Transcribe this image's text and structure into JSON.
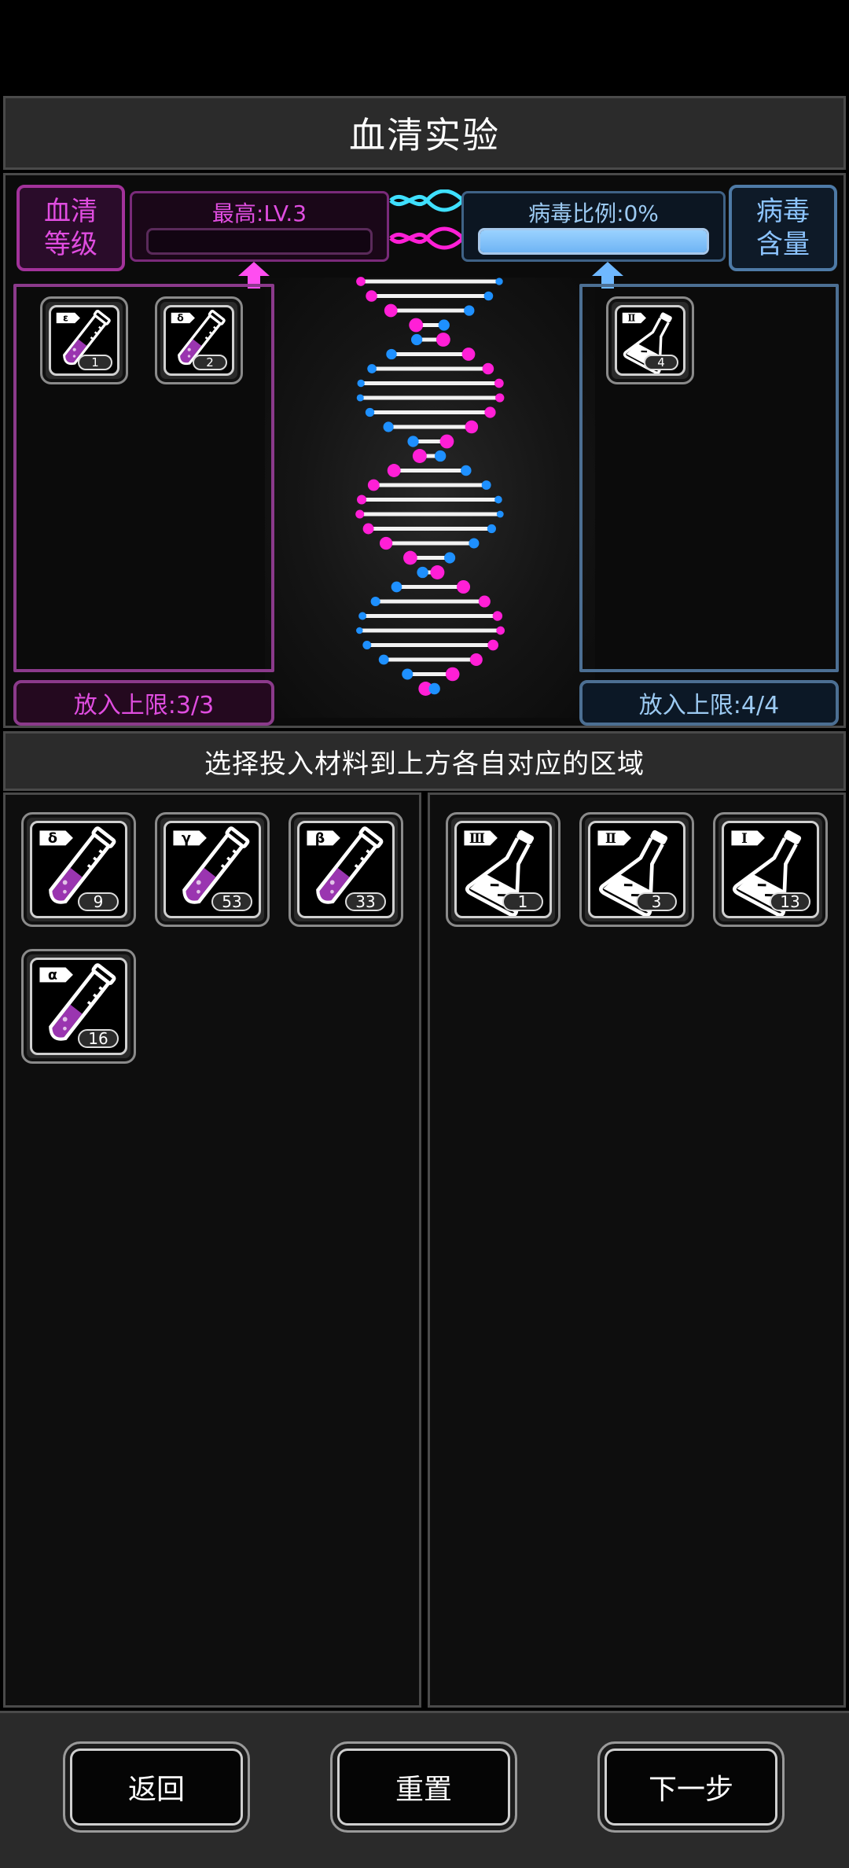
{
  "title": "血清实验",
  "serum": {
    "label": "血清\n等级",
    "caption": "最高:LV.3",
    "progress": 0,
    "limit": "放入上限:3/3",
    "placed": [
      {
        "symbol": "ε",
        "count": "1"
      },
      {
        "symbol": "δ",
        "count": "2"
      }
    ]
  },
  "virus": {
    "label": "病毒\n含量",
    "caption": "病毒比例:0%",
    "progress": 1,
    "limit": "放入上限:4/4",
    "placed": [
      {
        "symbol": "Ⅱ",
        "count": "4"
      }
    ]
  },
  "instruction": "选择投入材料到上方各自对应的区域",
  "inventory": {
    "serums": [
      {
        "symbol": "δ",
        "count": "9"
      },
      {
        "symbol": "γ",
        "count": "53"
      },
      {
        "symbol": "β",
        "count": "33"
      },
      {
        "symbol": "α",
        "count": "16"
      }
    ],
    "viruses": [
      {
        "symbol": "Ⅲ",
        "count": "1"
      },
      {
        "symbol": "Ⅱ",
        "count": "3"
      },
      {
        "symbol": "Ⅰ",
        "count": "13"
      }
    ]
  },
  "buttons": {
    "back": "返回",
    "reset": "重置",
    "next": "下一步"
  },
  "colors": {
    "serum_accent": "#e04de0",
    "virus_accent": "#9ccaf2",
    "dna_pink": "#ff1fd6",
    "dna_blue": "#1e90ff"
  },
  "icons": {
    "serum_item": "test-tube-icon",
    "virus_item": "flask-icon",
    "up_arrow": "up-arrow-icon",
    "dna": "dna-helix-icon"
  }
}
